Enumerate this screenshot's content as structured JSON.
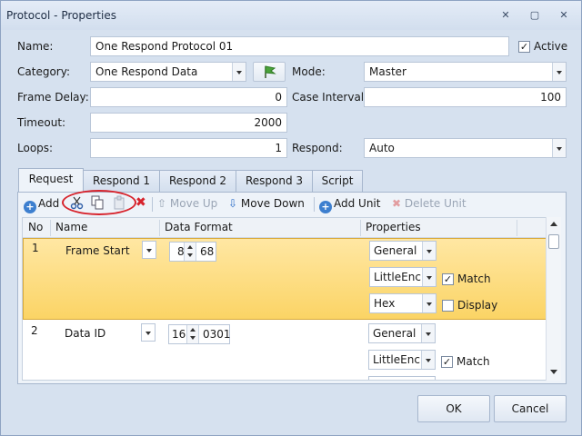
{
  "window": {
    "title": "Protocol - Properties"
  },
  "form": {
    "name_label": "Name:",
    "name_value": "One Respond  Protocol 01",
    "active_label": "Active",
    "active_checked": true,
    "category_label": "Category:",
    "category_value": "One Respond Data",
    "mode_label": "Mode:",
    "mode_value": "Master",
    "frame_delay_label": "Frame Delay:",
    "frame_delay_value": "0",
    "case_interval_label": "Case Interval:",
    "case_interval_value": "100",
    "timeout_label": "Timeout:",
    "timeout_value": "2000",
    "loops_label": "Loops:",
    "loops_value": "1",
    "respond_label": "Respond:",
    "respond_value": "Auto"
  },
  "tabs": [
    "Request",
    "Respond 1",
    "Respond 2",
    "Respond 3",
    "Script"
  ],
  "toolbar": {
    "add": "Add",
    "move_up": "Move Up",
    "move_down": "Move Down",
    "add_unit": "Add Unit",
    "delete_unit": "Delete Unit"
  },
  "grid": {
    "headers": [
      "No",
      "Name",
      "Data Format",
      "Properties"
    ],
    "rows": [
      {
        "no": "1",
        "name": "Frame Start",
        "len": "8",
        "format_value": "68",
        "props": [
          "General",
          "LittleEnc",
          "Hex"
        ],
        "match_label": "Match",
        "match_checked": true,
        "display_label": "Display",
        "display_checked": false
      },
      {
        "no": "2",
        "name": "Data ID",
        "len": "16",
        "format_value": "0301",
        "props": [
          "General",
          "LittleEnc"
        ],
        "match_label": "Match",
        "match_checked": true
      }
    ]
  },
  "buttons": {
    "ok": "OK",
    "cancel": "Cancel"
  },
  "icons": [
    "close-icon",
    "minimize-icon",
    "maximize-icon",
    "flag-icon",
    "cut-icon",
    "copy-icon",
    "paste-icon",
    "delete-icon",
    "arrow-up-icon",
    "arrow-down-icon",
    "add-icon"
  ],
  "colors": {
    "selection": "#fbd465",
    "highlight_ring": "#d7232c"
  }
}
